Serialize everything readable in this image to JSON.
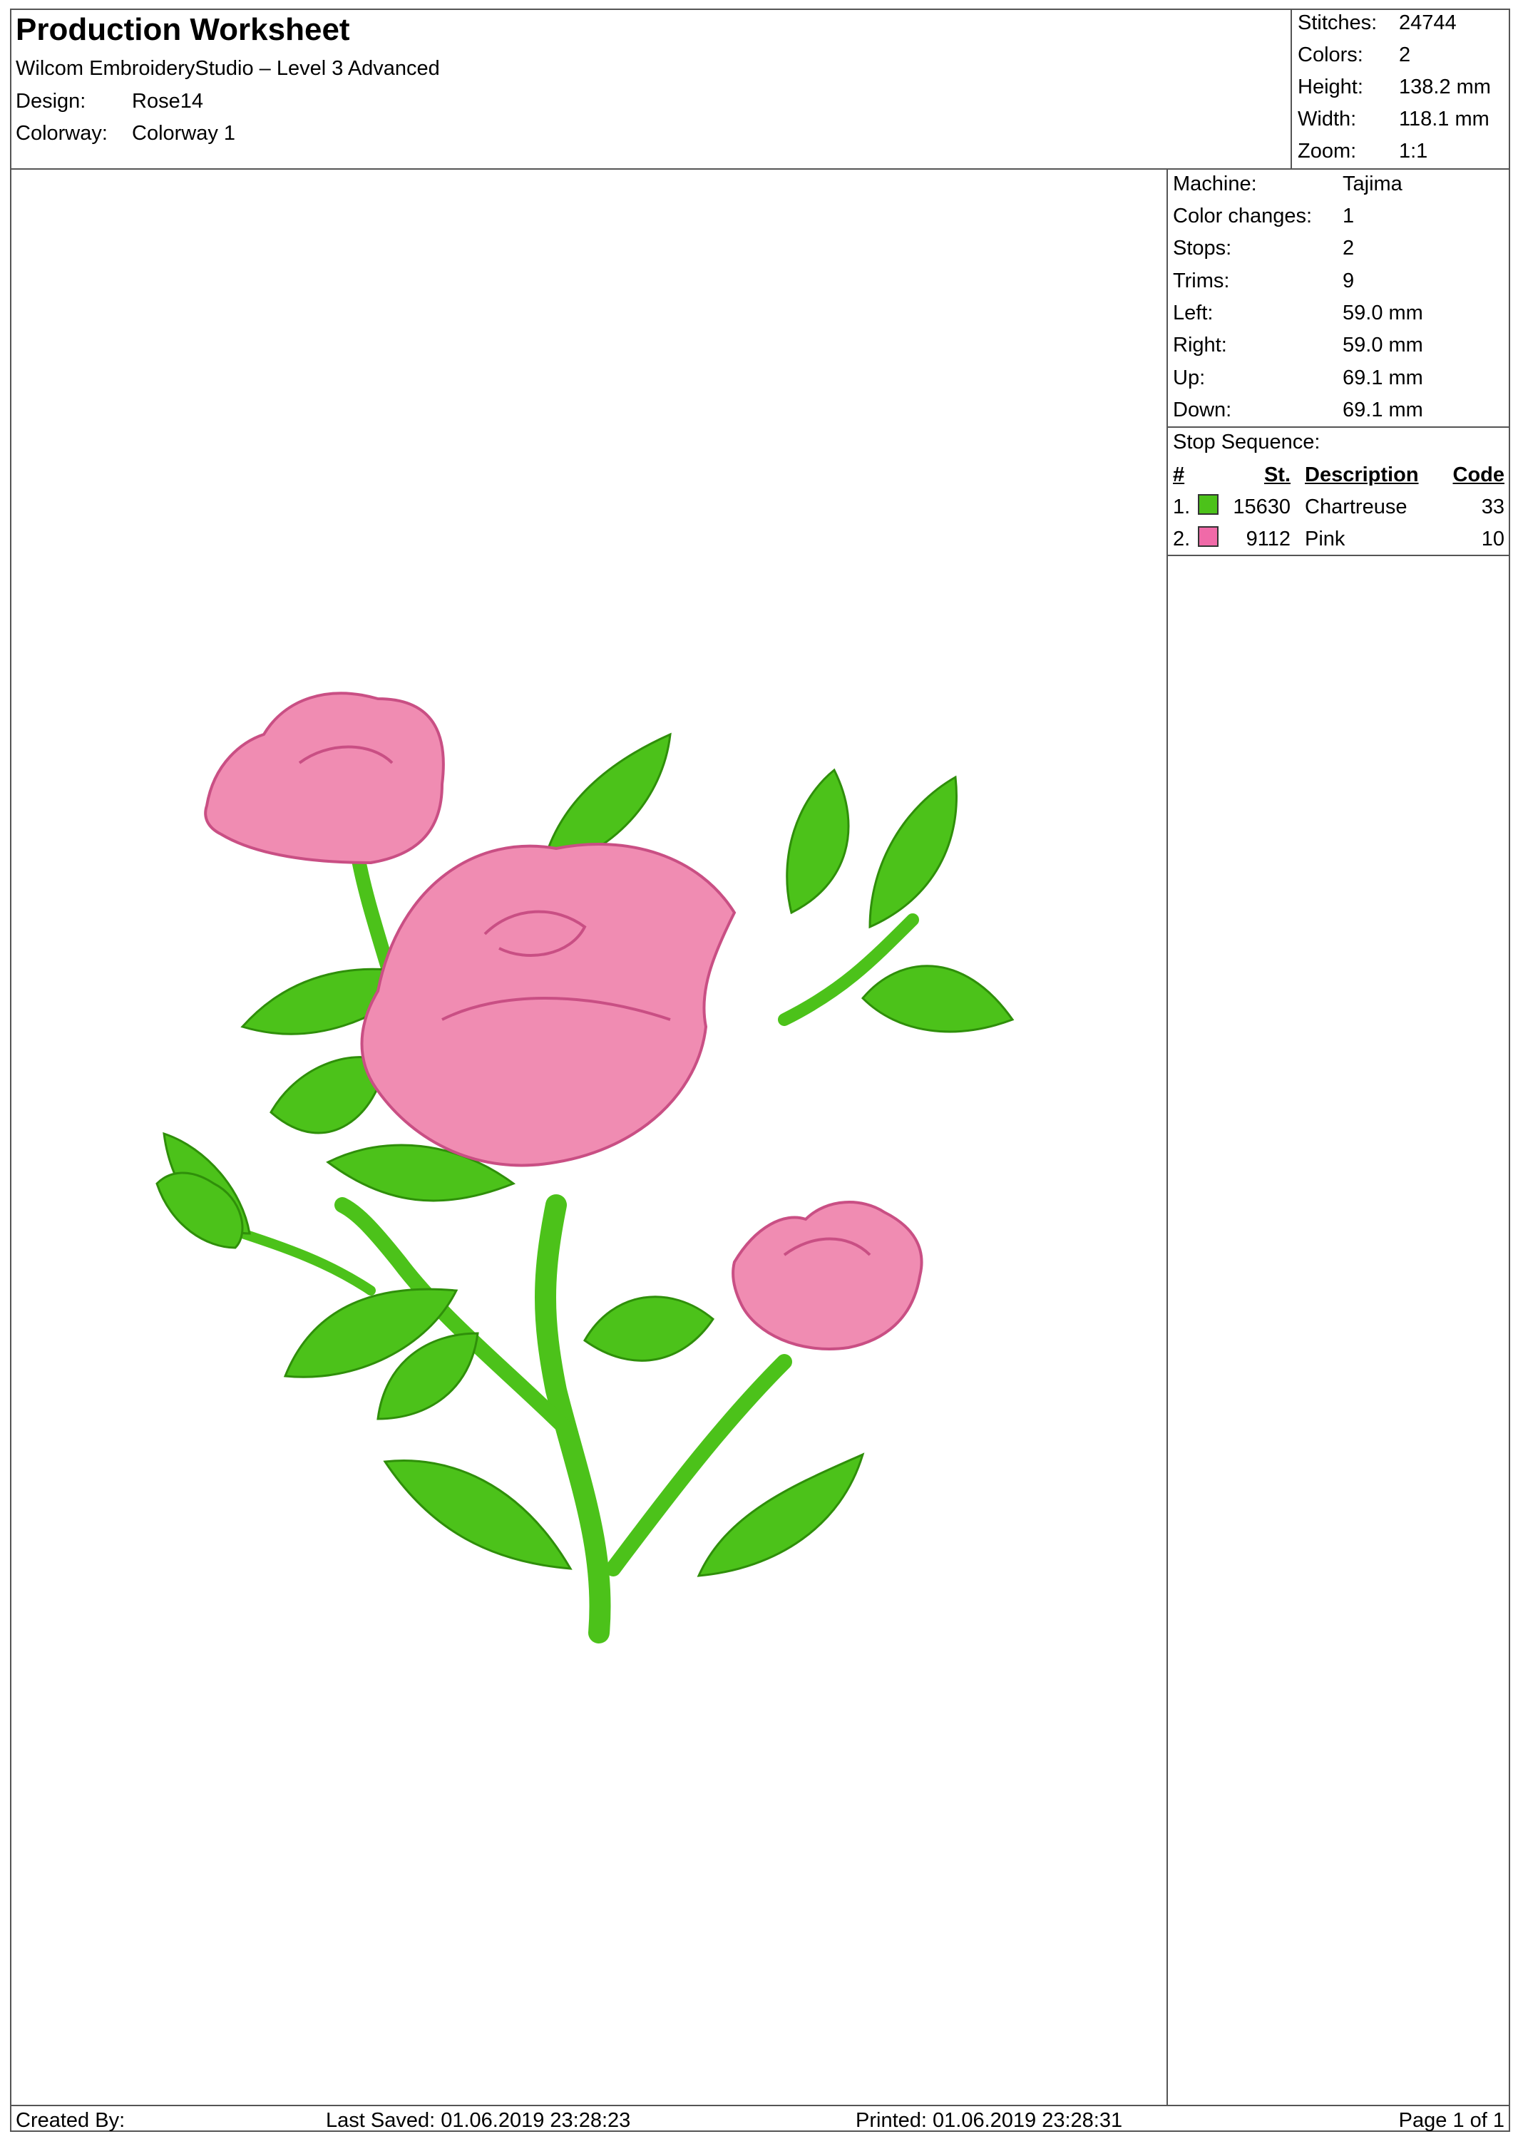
{
  "header": {
    "title": "Production Worksheet",
    "software": "Wilcom EmbroideryStudio – Level 3 Advanced",
    "design_label": "Design:",
    "design_value": "Rose14",
    "colorway_label": "Colorway:",
    "colorway_value": "Colorway 1"
  },
  "summary": {
    "stitches_label": "Stitches:",
    "stitches_value": "24744",
    "colors_label": "Colors:",
    "colors_value": "2",
    "height_label": "Height:",
    "height_value": "138.2 mm",
    "width_label": "Width:",
    "width_value": "118.1 mm",
    "zoom_label": "Zoom:",
    "zoom_value": "1:1"
  },
  "machine": {
    "machine_label": "Machine:",
    "machine_value": "Tajima",
    "color_changes_label": "Color changes:",
    "color_changes_value": "1",
    "stops_label": "Stops:",
    "stops_value": "2",
    "trims_label": "Trims:",
    "trims_value": "9",
    "left_label": "Left:",
    "left_value": "59.0 mm",
    "right_label": "Right:",
    "right_value": "59.0 mm",
    "up_label": "Up:",
    "up_value": "69.1 mm",
    "down_label": "Down:",
    "down_value": "69.1 mm"
  },
  "stop_sequence": {
    "title": "Stop Sequence:",
    "columns": {
      "num": "#",
      "st": "St.",
      "description": "Description",
      "code": "Code"
    },
    "rows": [
      {
        "num": "1.",
        "color": "#4cc21a",
        "st": "15630",
        "description": "Chartreuse",
        "code": "33"
      },
      {
        "num": "2.",
        "color": "#f06aa8",
        "st": "9112",
        "description": "Pink",
        "code": "10"
      }
    ]
  },
  "footer": {
    "created_by": "Created By:",
    "last_saved": "Last Saved: 01.06.2019 23:28:23",
    "printed": "Printed: 01.06.2019 23:28:31",
    "page": "Page 1 of 1"
  },
  "colors": {
    "thread_green": "#4cc21a",
    "thread_pink": "#f06aa8",
    "rule_line": "#555555"
  }
}
